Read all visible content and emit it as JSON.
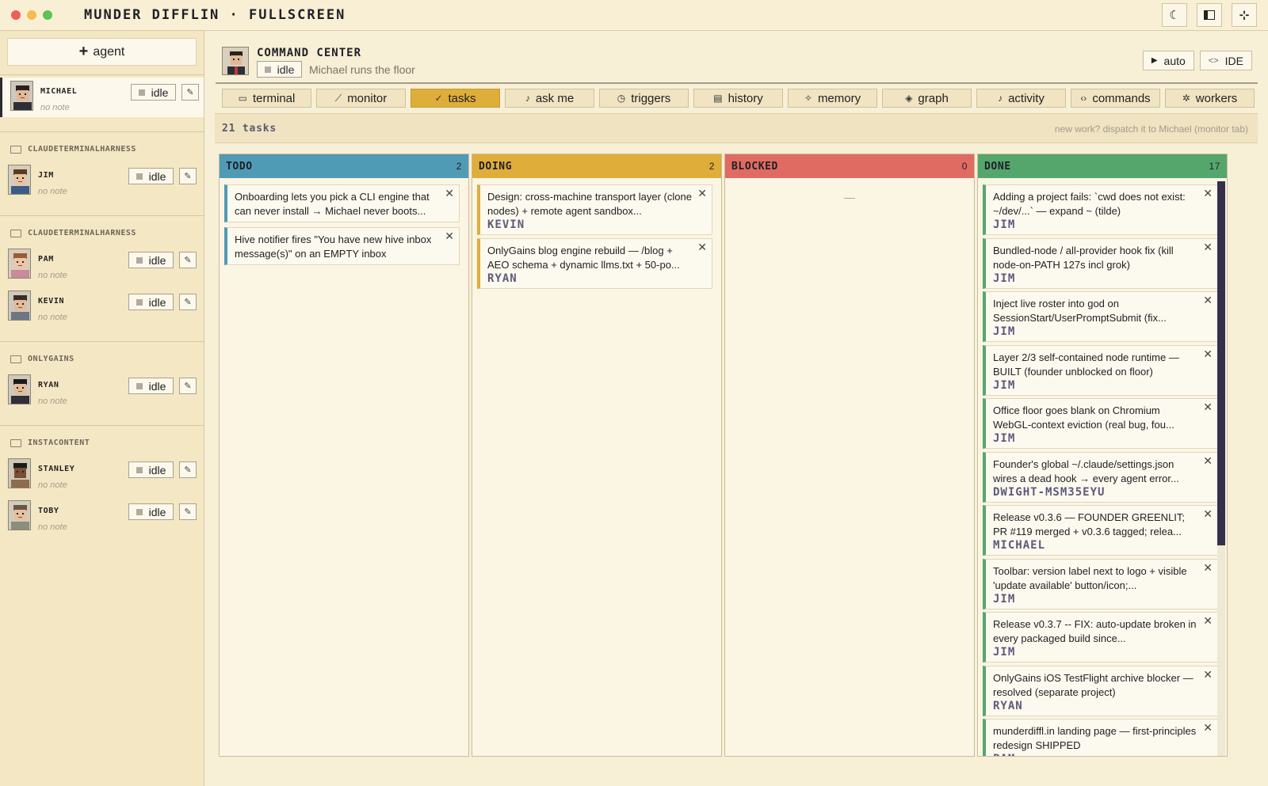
{
  "window": {
    "title": "MUNDER DIFFLIN · FULLSCREEN"
  },
  "sidebar": {
    "add_agent_label": "agent",
    "idle_label": "idle",
    "note_placeholder": "no note",
    "groups": [
      {
        "label": "",
        "agents": [
          {
            "name": "MICHAEL",
            "status": "idle",
            "note": "no note"
          }
        ]
      },
      {
        "label": "CLAUDETERMINALHARNESS",
        "agents": [
          {
            "name": "JIM",
            "status": "idle",
            "note": "no note"
          }
        ]
      },
      {
        "label": "CLAUDETERMINALHARNESS",
        "agents": [
          {
            "name": "PAM",
            "status": "idle",
            "note": "no note"
          },
          {
            "name": "KEVIN",
            "status": "idle",
            "note": "no note"
          }
        ]
      },
      {
        "label": "ONLYGAINS",
        "agents": [
          {
            "name": "RYAN",
            "status": "idle",
            "note": "no note"
          }
        ]
      },
      {
        "label": "INSTACONTENT",
        "agents": [
          {
            "name": "STANLEY",
            "status": "idle",
            "note": "no note"
          },
          {
            "name": "TOBY",
            "status": "idle",
            "note": "no note"
          }
        ]
      }
    ]
  },
  "header": {
    "title": "COMMAND CENTER",
    "status": "idle",
    "subtitle": "Michael runs the floor",
    "auto_label": "auto",
    "ide_label": "IDE"
  },
  "tabs": [
    {
      "label": "terminal",
      "icon": "terminal-icon"
    },
    {
      "label": "monitor",
      "icon": "monitor-icon"
    },
    {
      "label": "tasks",
      "icon": "check-icon",
      "active": true
    },
    {
      "label": "ask me",
      "icon": "bell-icon"
    },
    {
      "label": "triggers",
      "icon": "clock-icon"
    },
    {
      "label": "history",
      "icon": "document-icon"
    },
    {
      "label": "memory",
      "icon": "sparkle-icon"
    },
    {
      "label": "graph",
      "icon": "graph-icon"
    },
    {
      "label": "activity",
      "icon": "bell-icon"
    },
    {
      "label": "commands",
      "icon": "code-icon"
    },
    {
      "label": "workers",
      "icon": "gear-icon"
    }
  ],
  "tasks_bar": {
    "count_label": "21 tasks",
    "hint": "new work? dispatch it to Michael (monitor tab)"
  },
  "columns": [
    {
      "name": "TODO",
      "count": "2",
      "color": "#4f9bb5",
      "cards": [
        {
          "text": "Onboarding lets you pick a CLI engine that can never install → Michael never boots...",
          "who": ""
        },
        {
          "text": "Hive notifier fires \"You have new hive inbox message(s)\" on an EMPTY inbox",
          "who": ""
        }
      ]
    },
    {
      "name": "DOING",
      "count": "2",
      "color": "#dfad3a",
      "cards": [
        {
          "text": "Design: cross-machine transport layer (clone nodes) + remote agent sandbox...",
          "who": "KEVIN"
        },
        {
          "text": "OnlyGains blog engine rebuild — /blog + AEO schema + dynamic llms.txt + 50-po...",
          "who": "RYAN"
        }
      ]
    },
    {
      "name": "BLOCKED",
      "count": "0",
      "color": "#df6b62",
      "empty": "—",
      "cards": []
    },
    {
      "name": "DONE",
      "count": "17",
      "color": "#55a66d",
      "cards": [
        {
          "text": "Adding a project fails: `cwd does not exist: ~/dev/...` — expand ~ (tilde)",
          "who": "JIM"
        },
        {
          "text": "Bundled-node / all-provider hook fix (kill node-on-PATH 127s incl grok)",
          "who": "JIM"
        },
        {
          "text": "Inject live roster into god on SessionStart/UserPromptSubmit (fix...",
          "who": "JIM"
        },
        {
          "text": "Layer 2/3 self-contained node runtime — BUILT (founder unblocked on floor)",
          "who": "JIM"
        },
        {
          "text": "Office floor goes blank on Chromium WebGL-context eviction (real bug, fou...",
          "who": "JIM"
        },
        {
          "text": "Founder's global ~/.claude/settings.json wires a dead hook → every agent error...",
          "who": "DWIGHT-MSM35EYU"
        },
        {
          "text": "Release v0.3.6 — FOUNDER GREENLIT; PR #119 merged + v0.3.6 tagged; relea...",
          "who": "MICHAEL"
        },
        {
          "text": "Toolbar: version label next to logo + visible 'update available' button/icon;...",
          "who": "JIM"
        },
        {
          "text": "Release v0.3.7 -- FIX: auto-update broken in every packaged build since...",
          "who": "JIM"
        },
        {
          "text": "OnlyGains iOS TestFlight archive blocker — resolved (separate project)",
          "who": "RYAN"
        },
        {
          "text": "munderdiffl.in landing page — first-principles redesign SHIPPED",
          "who": "PAM"
        }
      ]
    }
  ]
}
